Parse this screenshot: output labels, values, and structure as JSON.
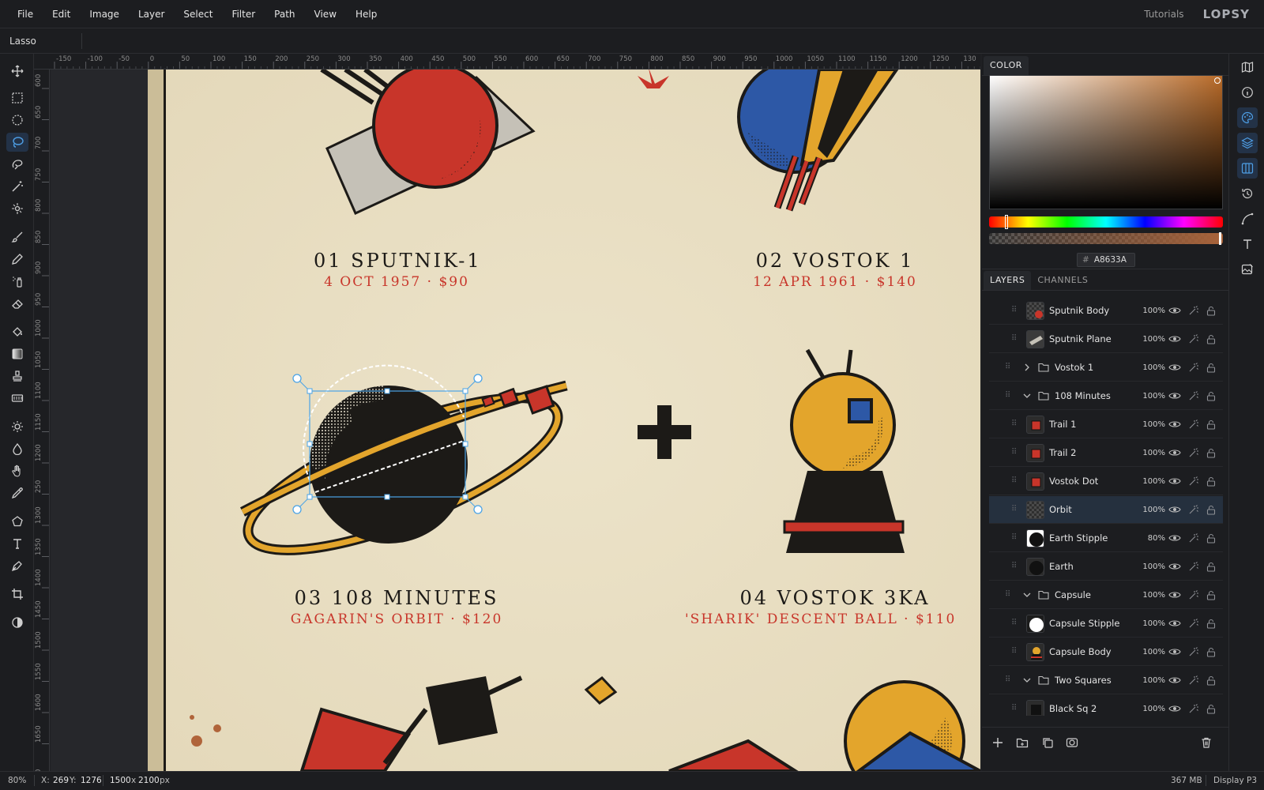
{
  "menubar": {
    "items": [
      "File",
      "Edit",
      "Image",
      "Layer",
      "Select",
      "Filter",
      "Path",
      "View",
      "Help"
    ],
    "tutorials": "Tutorials",
    "logo": "LOPSY"
  },
  "options": {
    "tool_name": "Lasso"
  },
  "tools": [
    {
      "name": "move-tool",
      "icon": "move-icon"
    },
    {
      "name": "rect-select-tool",
      "icon": "rect-select-icon"
    },
    {
      "name": "ellipse-select-tool",
      "icon": "ellipse-select-icon"
    },
    {
      "name": "lasso-tool",
      "icon": "lasso-icon",
      "active": true
    },
    {
      "name": "magnetic-lasso-tool",
      "icon": "magnetic-lasso-icon"
    },
    {
      "name": "magic-wand-tool",
      "icon": "magic-wand-icon"
    },
    {
      "name": "quick-select-tool",
      "icon": "quick-select-icon"
    },
    {
      "name": "brush-tool",
      "icon": "brush-icon"
    },
    {
      "name": "pencil-tool",
      "icon": "pencil-icon"
    },
    {
      "name": "spray-tool",
      "icon": "spray-icon"
    },
    {
      "name": "eraser-tool",
      "icon": "eraser-icon"
    },
    {
      "name": "bucket-tool",
      "icon": "bucket-icon"
    },
    {
      "name": "gradient-tool",
      "icon": "gradient-icon"
    },
    {
      "name": "stamp-tool",
      "icon": "stamp-icon"
    },
    {
      "name": "pattern-tool",
      "icon": "pattern-icon"
    },
    {
      "name": "dodge-tool",
      "icon": "sun-icon"
    },
    {
      "name": "burn-tool",
      "icon": "drop-icon"
    },
    {
      "name": "hand-tool",
      "icon": "hand-icon"
    },
    {
      "name": "eyedropper-tool",
      "icon": "eyedropper-icon"
    },
    {
      "name": "shape-tool",
      "icon": "pentagon-icon"
    },
    {
      "name": "text-tool",
      "icon": "text-icon"
    },
    {
      "name": "pen-tool",
      "icon": "pen-icon"
    },
    {
      "name": "crop-tool",
      "icon": "crop-icon"
    },
    {
      "name": "mask-tool",
      "icon": "contrast-icon"
    }
  ],
  "ruler_top": [
    "-150",
    "-100",
    "-50",
    "0",
    "50",
    "100",
    "150",
    "200",
    "250",
    "300",
    "350",
    "400",
    "450",
    "500",
    "550",
    "600",
    "650",
    "700",
    "750",
    "800",
    "850",
    "900",
    "950",
    "1000",
    "1050",
    "1100",
    "1150",
    "1200",
    "1250",
    "130"
  ],
  "ruler_left": [
    "600",
    "650",
    "700",
    "750",
    "800",
    "850",
    "900",
    "950",
    "1000",
    "1050",
    "1100",
    "1150",
    "1200",
    "250",
    "1300",
    "1350",
    "1400",
    "1450",
    "1500",
    "1550",
    "1600",
    "1650",
    "0"
  ],
  "artboard": {
    "titles": [
      {
        "title": "01  SPUTNIK-1",
        "sub": "4 OCT 1957  ·  $90"
      },
      {
        "title": "02  VOSTOK 1",
        "sub": "12 APR 1961  ·  $140"
      },
      {
        "title": "03  108 MINUTES",
        "sub": "GAGARIN'S ORBIT  ·  $120"
      },
      {
        "title": "04  VOSTOK 3KA",
        "sub": "'SHARIK' DESCENT BALL  ·  $110"
      }
    ]
  },
  "color_panel": {
    "tab": "COLOR",
    "hex": "A8633A",
    "current_color": "#A8633A"
  },
  "layers_panel": {
    "tabs": [
      "LAYERS",
      "CHANNELS"
    ],
    "layers": [
      {
        "name": "Sputnik Body",
        "opacity": "100%",
        "kind": "layer",
        "depth": 1,
        "thumb": "red-circle"
      },
      {
        "name": "Sputnik Plane",
        "opacity": "100%",
        "kind": "layer",
        "depth": 1,
        "thumb": "gray-plane"
      },
      {
        "name": "Vostok 1",
        "opacity": "100%",
        "kind": "group",
        "collapsed": true,
        "depth": 0
      },
      {
        "name": "108 Minutes",
        "opacity": "100%",
        "kind": "group",
        "collapsed": false,
        "depth": 0
      },
      {
        "name": "Trail 1",
        "opacity": "100%",
        "kind": "layer",
        "depth": 1,
        "thumb": "red-square"
      },
      {
        "name": "Trail 2",
        "opacity": "100%",
        "kind": "layer",
        "depth": 1,
        "thumb": "red-square"
      },
      {
        "name": "Vostok Dot",
        "opacity": "100%",
        "kind": "layer",
        "depth": 1,
        "thumb": "red-square"
      },
      {
        "name": "Orbit",
        "opacity": "100%",
        "kind": "layer",
        "depth": 1,
        "thumb": "transparent",
        "selected": true
      },
      {
        "name": "Earth Stipple",
        "opacity": "80%",
        "kind": "layer",
        "depth": 1,
        "thumb": "stipple"
      },
      {
        "name": "Earth",
        "opacity": "100%",
        "kind": "layer",
        "depth": 1,
        "thumb": "dark-circle"
      },
      {
        "name": "Capsule",
        "opacity": "100%",
        "kind": "group",
        "collapsed": false,
        "depth": 0
      },
      {
        "name": "Capsule Stipple",
        "opacity": "100%",
        "kind": "layer",
        "depth": 1,
        "thumb": "white-stipple"
      },
      {
        "name": "Capsule Body",
        "opacity": "100%",
        "kind": "layer",
        "depth": 1,
        "thumb": "capsule"
      },
      {
        "name": "Two Squares",
        "opacity": "100%",
        "kind": "group",
        "collapsed": false,
        "depth": 0
      },
      {
        "name": "Black Sq 2",
        "opacity": "100%",
        "kind": "layer",
        "depth": 1,
        "thumb": "dark-square"
      }
    ]
  },
  "statusbar": {
    "zoom": "80%",
    "x_label": "X:",
    "x_value": "269",
    "y_label": "Y:",
    "y_value": "1276",
    "size_w": "1500",
    "size_x": "x",
    "size_h": "2100",
    "size_unit": "px",
    "memory": "367 MB",
    "profile": "Display P3"
  }
}
